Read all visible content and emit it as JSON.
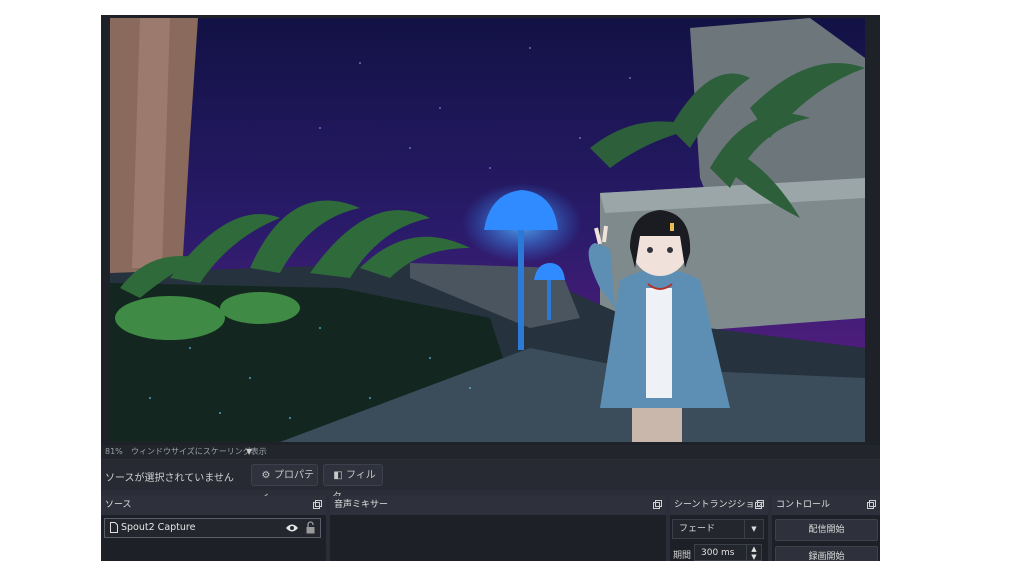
{
  "preview": {
    "zoom": "81%",
    "mode_label": "ウィンドウサイズにスケーリング表示"
  },
  "context_bar": {
    "no_selection": "ソースが選択されていません",
    "properties_label": "プロパティ",
    "filters_label": "フィルタ"
  },
  "docks": {
    "sources": {
      "title": "ソース",
      "items": [
        {
          "name": "Spout2 Capture"
        }
      ]
    },
    "mixer": {
      "title": "音声ミキサー"
    },
    "transitions": {
      "title": "シーントランジション",
      "selected": "フェード",
      "duration_label": "期間",
      "duration_value": "300 ms"
    },
    "controls": {
      "title": "コントロール",
      "start_streaming": "配信開始",
      "start_recording": "録画開始"
    }
  },
  "icons": {
    "properties": "gear-icon",
    "filters": "filter-icon",
    "undock": "undock-icon",
    "source_type": "document-icon",
    "visibility": "eye-icon",
    "lock": "lock-icon"
  },
  "colors": {
    "panel_bg": "#2b2e38",
    "dock_header": "#2e313b",
    "mushroom_glow": "#2f8bff",
    "sky_top": "#141446",
    "sky_bottom": "#6a1f8a"
  }
}
